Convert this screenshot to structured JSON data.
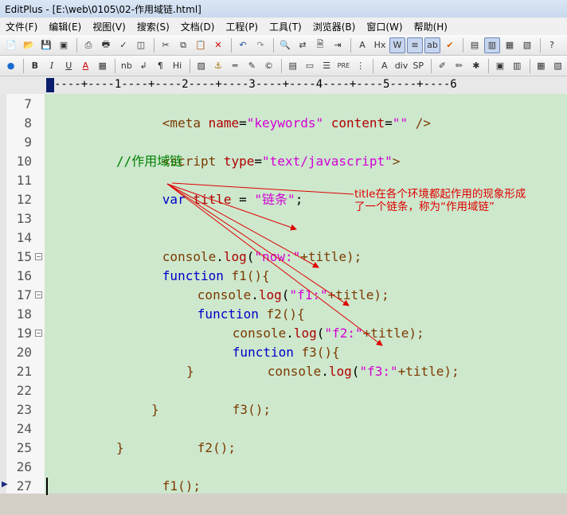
{
  "window": {
    "title": "EditPlus - [E:\\web\\0105\\02-作用域链.html]"
  },
  "menu": [
    "文件(F)",
    "编辑(E)",
    "视图(V)",
    "搜索(S)",
    "文档(D)",
    "工程(P)",
    "工具(T)",
    "浏览器(B)",
    "窗口(W)",
    "帮助(H)"
  ],
  "toolbar_formatting": {
    "bold": "B",
    "italic": "I",
    "underline": "U",
    "font_color": "A",
    "nb": "nb",
    "newline": "↲",
    "para": "¶",
    "hi": "Hi",
    "pre": "PRE",
    "div": "div",
    "sp": "SP",
    "hx": "Hx"
  },
  "ruler": {
    "text": "----+----1----+----2----+----3----+----4----+----5----+----6"
  },
  "lines": [
    {
      "n": "7"
    },
    {
      "n": "8"
    },
    {
      "n": "9"
    },
    {
      "n": "10"
    },
    {
      "n": "11"
    },
    {
      "n": "12"
    },
    {
      "n": "13"
    },
    {
      "n": "14"
    },
    {
      "n": "15"
    },
    {
      "n": "16"
    },
    {
      "n": "17"
    },
    {
      "n": "18"
    },
    {
      "n": "19"
    },
    {
      "n": "20"
    },
    {
      "n": "21"
    },
    {
      "n": "22"
    },
    {
      "n": "23"
    },
    {
      "n": "24"
    },
    {
      "n": "25"
    },
    {
      "n": "26"
    },
    {
      "n": "27"
    }
  ],
  "code": {
    "l7": {
      "open": "<meta ",
      "a1": "name",
      "eq1": "=",
      "v1": "\"keywords\"",
      "a2": " content",
      "eq2": "=",
      "v2": "\"\"",
      "close": " />"
    },
    "l9": {
      "open": "<script ",
      "a1": "type",
      "eq1": "=",
      "v1": "\"text/javascript\"",
      "close": ">"
    },
    "l10": "//作用域链",
    "l11": {
      "kw": "var ",
      "name": "title",
      "eq": " = ",
      "val": "\"链条\"",
      "semi": ";"
    },
    "l14": {
      "obj": "console",
      "dot": ".",
      "fn": "log",
      "p1": "(",
      "s": "\"now:\"",
      "rest": "+title);"
    },
    "l15": {
      "kw": "function ",
      "fn": "f1",
      "rest": "(){"
    },
    "l16": {
      "obj": "console",
      "dot": ".",
      "fn": "log",
      "p1": "(",
      "s": "\"f1:\"",
      "rest": "+title);"
    },
    "l17": {
      "kw": "function ",
      "fn": "f2",
      "rest": "(){"
    },
    "l18": {
      "obj": "console",
      "dot": ".",
      "fn": "log",
      "p1": "(",
      "s": "\"f2:\"",
      "rest": "+title);"
    },
    "l19": {
      "kw": "function ",
      "fn": "f3",
      "rest": "(){"
    },
    "l20": {
      "obj": "console",
      "dot": ".",
      "fn": "log",
      "p1": "(",
      "s": "\"f3:\"",
      "rest": "+title);"
    },
    "l21": "}",
    "l22": {
      "fn": "f3",
      "rest": "();"
    },
    "l23": "}",
    "l24": {
      "fn": "f2",
      "rest": "();"
    },
    "l25": "}",
    "l26": {
      "fn": "f1",
      "rest": "();"
    }
  },
  "annotation": {
    "line1": "title在各个环境都起作用的现象形成",
    "line2": "了一个链条，称为“作用域链”"
  },
  "colors": {
    "editor_bg": "#cde8cd",
    "keyword": "#0000c8",
    "string": "#d400d4",
    "attr": "#b00000",
    "comment": "#008000",
    "arrow": "#e00000"
  }
}
